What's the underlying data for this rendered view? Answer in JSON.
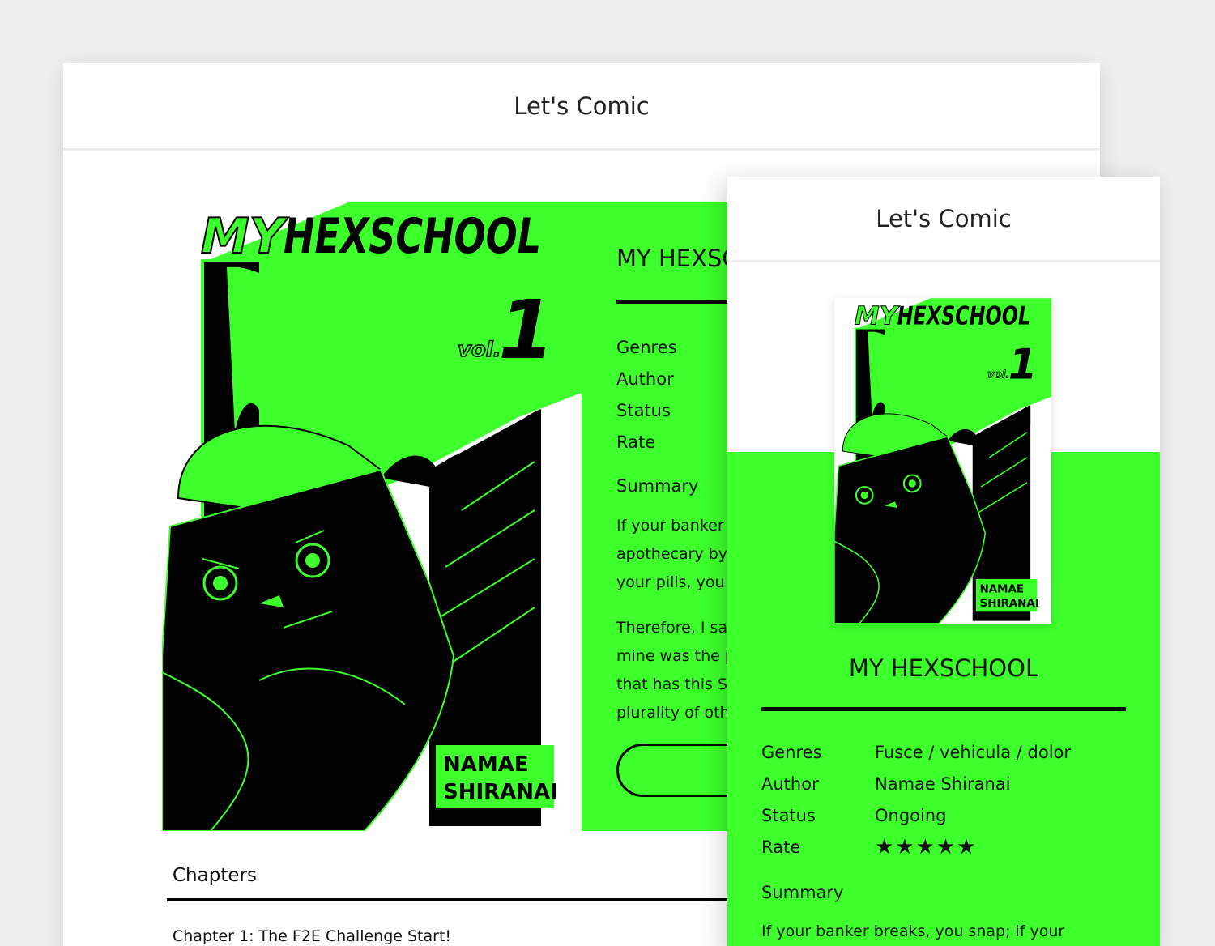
{
  "app": {
    "title": "Let's Comic"
  },
  "book": {
    "title": "MY HEXSCHOOL",
    "cover": {
      "series_title_1": "MY",
      "series_title_2": "HEXSCHOOL",
      "vol_label": "vol.",
      "vol_number": "1",
      "author_line_1": "NAMAE",
      "author_line_2": "SHIRANAI"
    },
    "meta_labels": {
      "genres": "Genres",
      "author": "Author",
      "status": "Status",
      "rate": "Rate"
    },
    "meta_values": {
      "genres": "Fusce / vehicula / dolor",
      "author": "Namae Shiranai",
      "status": "Ongoing",
      "rate_stars": "★★★★★",
      "rating": 5
    },
    "summary_label": "Summary",
    "desktop_summary_p1_lines": [
      "If your banker b",
      "apothecary by",
      "your pills, you c"
    ],
    "desktop_summary_p2_lines": [
      "Therefore, I say",
      "mine was the p",
      "that has this Si",
      "plurality of oth"
    ],
    "desktop_title_visible": "MY HEXSC",
    "mobile_summary_line": "If your banker breaks, you snap; if your"
  },
  "chapters": {
    "heading": "Chapters",
    "items": [
      {
        "label": "Chapter 1: The F2E Challenge Start!"
      }
    ]
  },
  "colors": {
    "accent": "#3cff2b",
    "ink": "#000000",
    "page_bg": "#efefef"
  }
}
